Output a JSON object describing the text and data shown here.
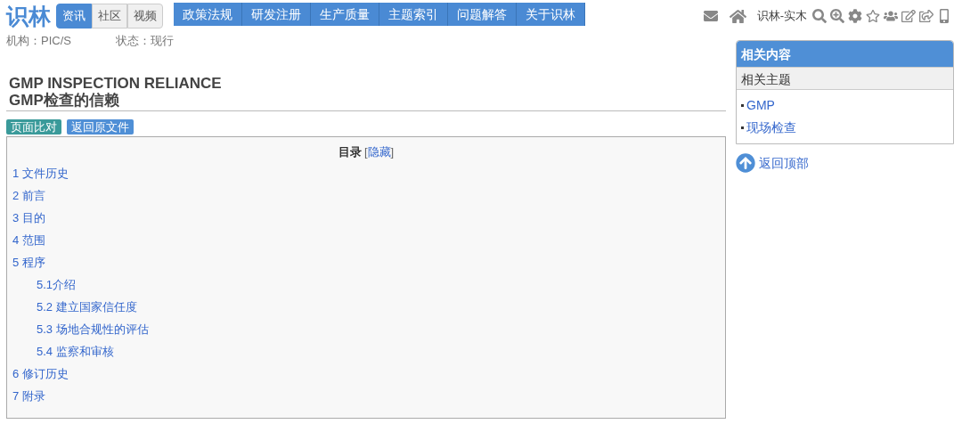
{
  "logo": "识林",
  "tabs": [
    {
      "label": "资讯",
      "selected": true
    },
    {
      "label": "社区",
      "selected": false
    },
    {
      "label": "视频",
      "selected": false
    }
  ],
  "nav": [
    "政策法规",
    "研发注册",
    "生产质量",
    "主题索引",
    "问题解答",
    "关于识林"
  ],
  "user": "识林-实木",
  "meta": [
    {
      "label": "机构：PIC/S"
    },
    {
      "label": "状态：现行"
    }
  ],
  "title_en": "GMP INSPECTION RELIANCE",
  "title_zh": "GMP检查的信赖",
  "actions": [
    {
      "label": "页面比对",
      "kind": "compare"
    },
    {
      "label": "返回原文件",
      "kind": "back"
    }
  ],
  "toc": {
    "title": "目录",
    "toggle_open": "[",
    "toggle": "隐藏",
    "toggle_close": "]",
    "items": [
      {
        "label": "1 文件历史"
      },
      {
        "label": "2 前言"
      },
      {
        "label": "3 目的"
      },
      {
        "label": "4 范围"
      },
      {
        "label": "5 程序",
        "children": [
          {
            "label": "5.1介绍"
          },
          {
            "label": "5.2 建立国家信任度"
          },
          {
            "label": "5.3 场地合规性的评估"
          },
          {
            "label": "5.4 监察和审核"
          }
        ]
      },
      {
        "label": "6 修订历史"
      },
      {
        "label": "7 附录"
      }
    ]
  },
  "sidebar": {
    "title": "相关内容",
    "subtitle": "相关主题",
    "links": [
      "GMP",
      "现场检查"
    ],
    "back_to_top": "返回顶部"
  }
}
